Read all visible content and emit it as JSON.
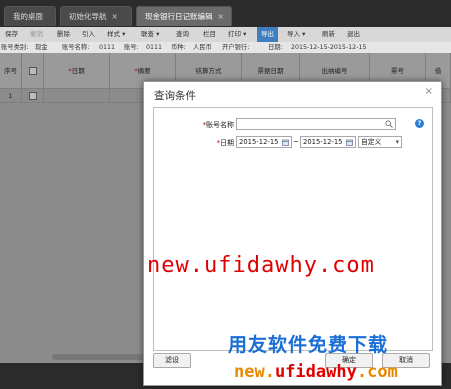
{
  "tabs": [
    {
      "label": "我的桌面"
    },
    {
      "label": "初始化导航",
      "close": "×"
    },
    {
      "label": "现金银行日记账编辑",
      "close": "×"
    }
  ],
  "toolbar": {
    "save": "保存",
    "undo": "撤销",
    "delete": "删除",
    "import_in": "引入",
    "style": "样式",
    "link": "联查",
    "query": "查询",
    "columns": "栏目",
    "print": "打印",
    "export": "导出",
    "import": "导入",
    "refresh": "刷新",
    "exit": "退出",
    "dropdown_arrow": "▾"
  },
  "info_bar": {
    "account_type_label": "账号类别:",
    "account_type": "现金",
    "account_name_label": "账号名称:",
    "account_name": "0111",
    "account_no_label": "账号:",
    "account_no": "0111",
    "currency_label": "币种:",
    "currency": "人民币",
    "bank_label": "开户银行:",
    "date_label": "日期:",
    "date_range": "2015-12-15-2015-12-15"
  },
  "grid": {
    "columns": [
      "序号",
      "",
      "日期",
      "摘要",
      "结算方式",
      "票据日期",
      "出纳编号",
      "票号",
      "借"
    ],
    "required_mark": "*",
    "rows": [
      {
        "index": "1"
      }
    ]
  },
  "dialog": {
    "title": "查询条件",
    "close": "×",
    "account_name_label": "账号名称",
    "account_name_value": "",
    "search_icon": "magnifier-icon",
    "date_label": "日期",
    "date_from": "2015-12-15",
    "date_sep": "~",
    "date_to": "2015-12-15",
    "date_preset": "自定义",
    "help": "?",
    "filter_button": "滤设",
    "ok_button": "确定",
    "cancel_button": "取消"
  },
  "watermarks": {
    "big_url": "new.ufidawhy.com",
    "cn_text": "用友软件免费下载",
    "small_url_prefix": "new.",
    "small_url_main": "ufidawhy",
    "small_url_suffix": ".com"
  },
  "colors": {
    "export_highlight": "#3f7fbf",
    "help_icon": "#2d7fd6",
    "watermark_red": "#e00000",
    "watermark_blue": "#1a6fd6",
    "watermark_orange": "#e88a00"
  }
}
